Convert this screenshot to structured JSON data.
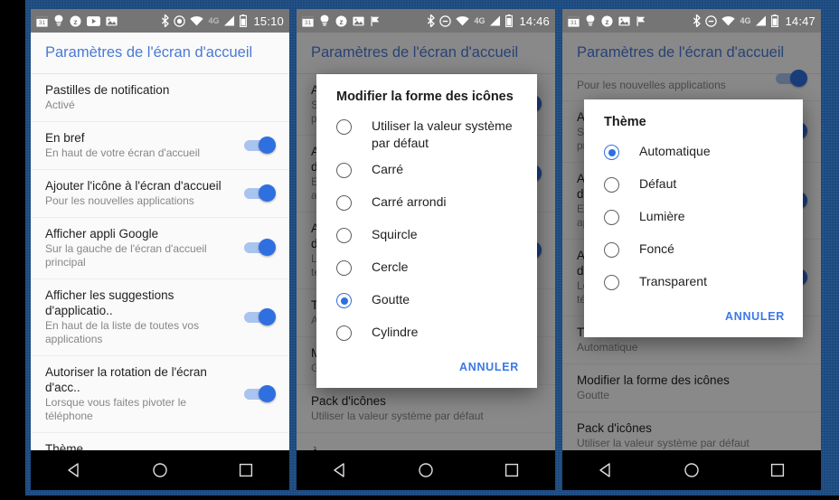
{
  "app": {
    "title": "Paramètres de l'écran d'accueil"
  },
  "status_bars": [
    {
      "time": "15:10",
      "network": "4G"
    },
    {
      "time": "14:46",
      "network": "4G"
    },
    {
      "time": "14:47",
      "network": "4G"
    }
  ],
  "status_icons": {
    "left": [
      "calendar-icon",
      "bulb-icon",
      "zedge-icon",
      "youtube-icon",
      "photos-icon"
    ],
    "left_extra": "flag-icon",
    "right": [
      "bluetooth-icon",
      "location-icon",
      "wifi-icon",
      "network-4g-label",
      "signal-icon",
      "battery-icon"
    ]
  },
  "settings_list": [
    {
      "title": "Pastilles de notification",
      "subtitle": "Activé",
      "toggle": false
    },
    {
      "title": "En bref",
      "subtitle": "En haut de votre écran d'accueil",
      "toggle": true
    },
    {
      "title": "Ajouter l'icône à l'écran d'accueil",
      "subtitle": "Pour les nouvelles applications",
      "toggle": true
    },
    {
      "title": "Afficher appli Google",
      "subtitle": "Sur la gauche de l'écran d'accueil principal",
      "toggle": true
    },
    {
      "title": "Afficher les suggestions d'applicatio..",
      "subtitle": "En haut de la liste de toutes vos applications",
      "toggle": true
    },
    {
      "title": "Autoriser la rotation de l'écran d'acc..",
      "subtitle": "Lorsque vous faites pivoter le téléphone",
      "toggle": true
    },
    {
      "title": "Thème",
      "subtitle": "Automatique",
      "toggle": false
    },
    {
      "title": "Modifier la forme des icônes",
      "subtitle": "Goutte",
      "toggle": false
    },
    {
      "title": "Pack d'icônes",
      "subtitle": "Utiliser la valeur système par défaut",
      "toggle": false
    },
    {
      "title": "À propos",
      "subtitle": "",
      "toggle": false
    }
  ],
  "dialog_shape": {
    "title": "Modifier la forme des icônes",
    "options": [
      {
        "label": "Utiliser la valeur système par défaut",
        "selected": false
      },
      {
        "label": "Carré",
        "selected": false
      },
      {
        "label": "Carré arrondi",
        "selected": false
      },
      {
        "label": "Squircle",
        "selected": false
      },
      {
        "label": "Cercle",
        "selected": false
      },
      {
        "label": "Goutte",
        "selected": true
      },
      {
        "label": "Cylindre",
        "selected": false
      }
    ],
    "cancel_label": "ANNULER"
  },
  "dialog_theme": {
    "title": "Thème",
    "options": [
      {
        "label": "Automatique",
        "selected": true
      },
      {
        "label": "Défaut",
        "selected": false
      },
      {
        "label": "Lumière",
        "selected": false
      },
      {
        "label": "Foncé",
        "selected": false
      },
      {
        "label": "Transparent",
        "selected": false
      }
    ],
    "cancel_label": "ANNULER"
  },
  "navbar": {
    "back": "back-triangle-icon",
    "home": "home-circle-icon",
    "recents": "recents-square-icon"
  },
  "colors": {
    "backdrop": "#1c4c84",
    "accent": "#2f6fe0",
    "header_text": "#4a79d4",
    "statusbar": "#757575",
    "link": "#3b78e7"
  }
}
